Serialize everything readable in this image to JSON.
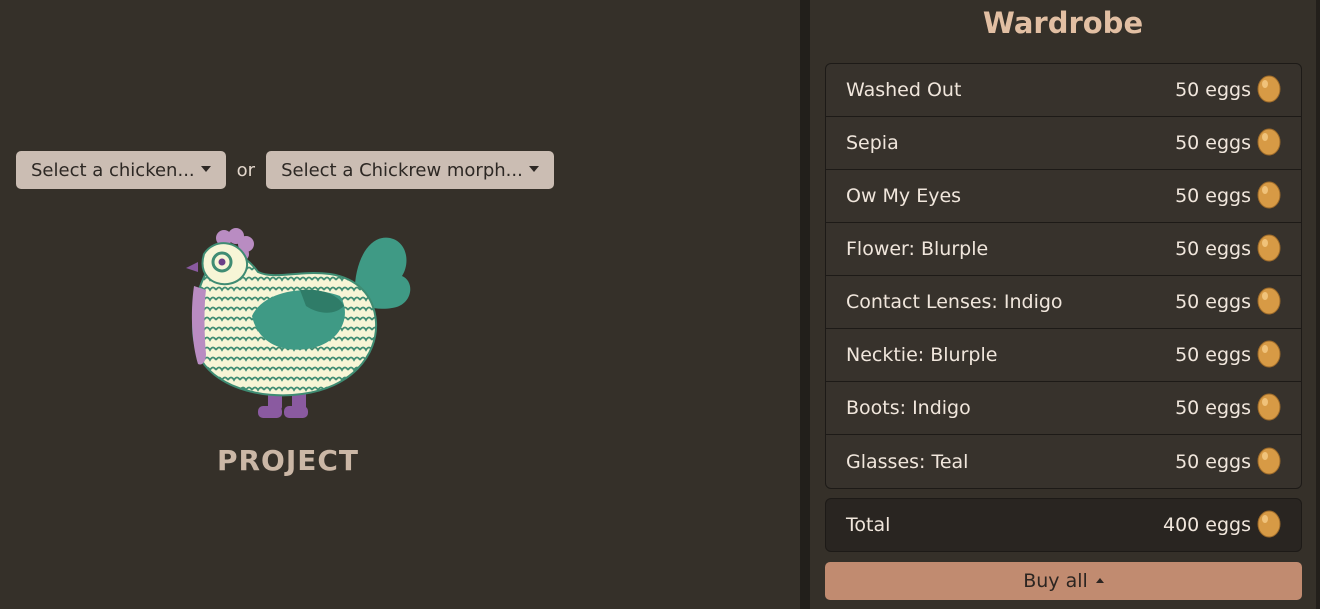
{
  "selectors": {
    "chicken_label": "Select a chicken...",
    "or_text": "or",
    "morph_label": "Select a Chickrew morph..."
  },
  "project": {
    "name": "PROJECT"
  },
  "wardrobe": {
    "title": "Wardrobe",
    "items": [
      {
        "name": "Washed Out",
        "price": "50 eggs"
      },
      {
        "name": "Sepia",
        "price": "50 eggs"
      },
      {
        "name": "Ow My Eyes",
        "price": "50 eggs"
      },
      {
        "name": "Flower: Blurple",
        "price": "50 eggs"
      },
      {
        "name": "Contact Lenses: Indigo",
        "price": "50 eggs"
      },
      {
        "name": "Necktie: Blurple",
        "price": "50 eggs"
      },
      {
        "name": "Boots: Indigo",
        "price": "50 eggs"
      },
      {
        "name": "Glasses: Teal",
        "price": "50 eggs"
      }
    ],
    "total_label": "Total",
    "total_value": "400 eggs",
    "buy_label": "Buy all"
  },
  "icons": {
    "currency": "egg-icon",
    "select_caret": "caret-down-icon",
    "buy_caret": "caret-up-icon",
    "chicken": "chicken-illustration"
  },
  "colors": {
    "background": "#353029",
    "select_button": "#cbbdb3",
    "title": "#e2bfa3",
    "buy_button": "#c18b70",
    "chicken_teal": "#3f9a85",
    "chicken_cream": "#f7f5d6",
    "accent_purple": "#8a5aa0"
  }
}
